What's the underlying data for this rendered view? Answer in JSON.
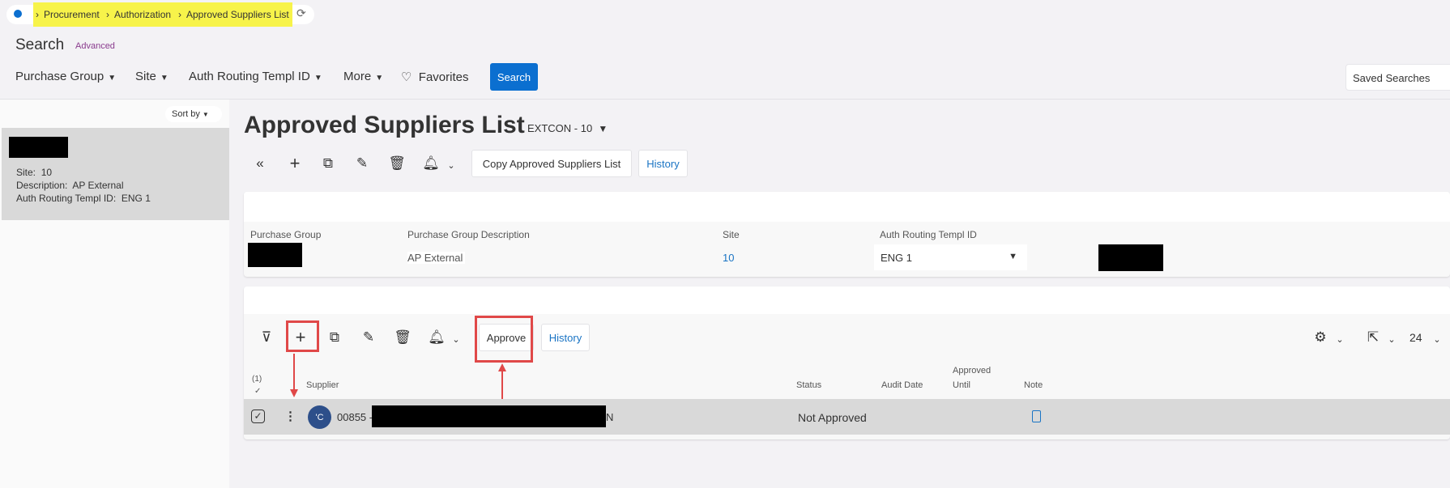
{
  "breadcrumb": {
    "items": [
      "Procurement",
      "Authorization",
      "Approved Suppliers List"
    ]
  },
  "search": {
    "title": "Search",
    "advanced": "Advanced",
    "filters": [
      "Purchase Group",
      "Site",
      "Auth Routing Templ ID",
      "More"
    ],
    "favorites": "Favorites",
    "search_button": "Search",
    "saved_searches": "Saved Searches"
  },
  "sidebar": {
    "sort_by": "Sort by",
    "record": {
      "site_label": "Site:",
      "site": "10",
      "desc_label": "Description:",
      "desc": "AP External",
      "auth_label": "Auth Routing Templ ID:",
      "auth": "ENG 1"
    }
  },
  "page": {
    "title": "Approved Suppliers List",
    "record_id": "EXTCON - 10",
    "copy_button": "Copy Approved Suppliers List",
    "history_button": "History"
  },
  "header_card": {
    "fields": [
      {
        "label": "Purchase Group"
      },
      {
        "label": "Purchase Group Description",
        "value": "AP External"
      },
      {
        "label": "Site",
        "value": "10"
      },
      {
        "label": "Auth Routing Templ ID",
        "value": "ENG 1"
      }
    ]
  },
  "lines": {
    "approve_button": "Approve",
    "history_button": "History",
    "page_size": "24",
    "selected_count": "(1)",
    "columns": {
      "supplier": "Supplier",
      "status": "Status",
      "audit_date": "Audit Date",
      "approved_until_1": "Approved",
      "approved_until_2": "Until",
      "note": "Note"
    },
    "rows": [
      {
        "avatar": "'C",
        "supplier_id": "00855 -",
        "supplier_tail": "N",
        "status": "Not Approved"
      }
    ]
  },
  "colors": {
    "accent": "#0b6fd0",
    "highlight": "#f7f34a",
    "annotation": "#e04848",
    "avatar": "#2d4f8a"
  }
}
